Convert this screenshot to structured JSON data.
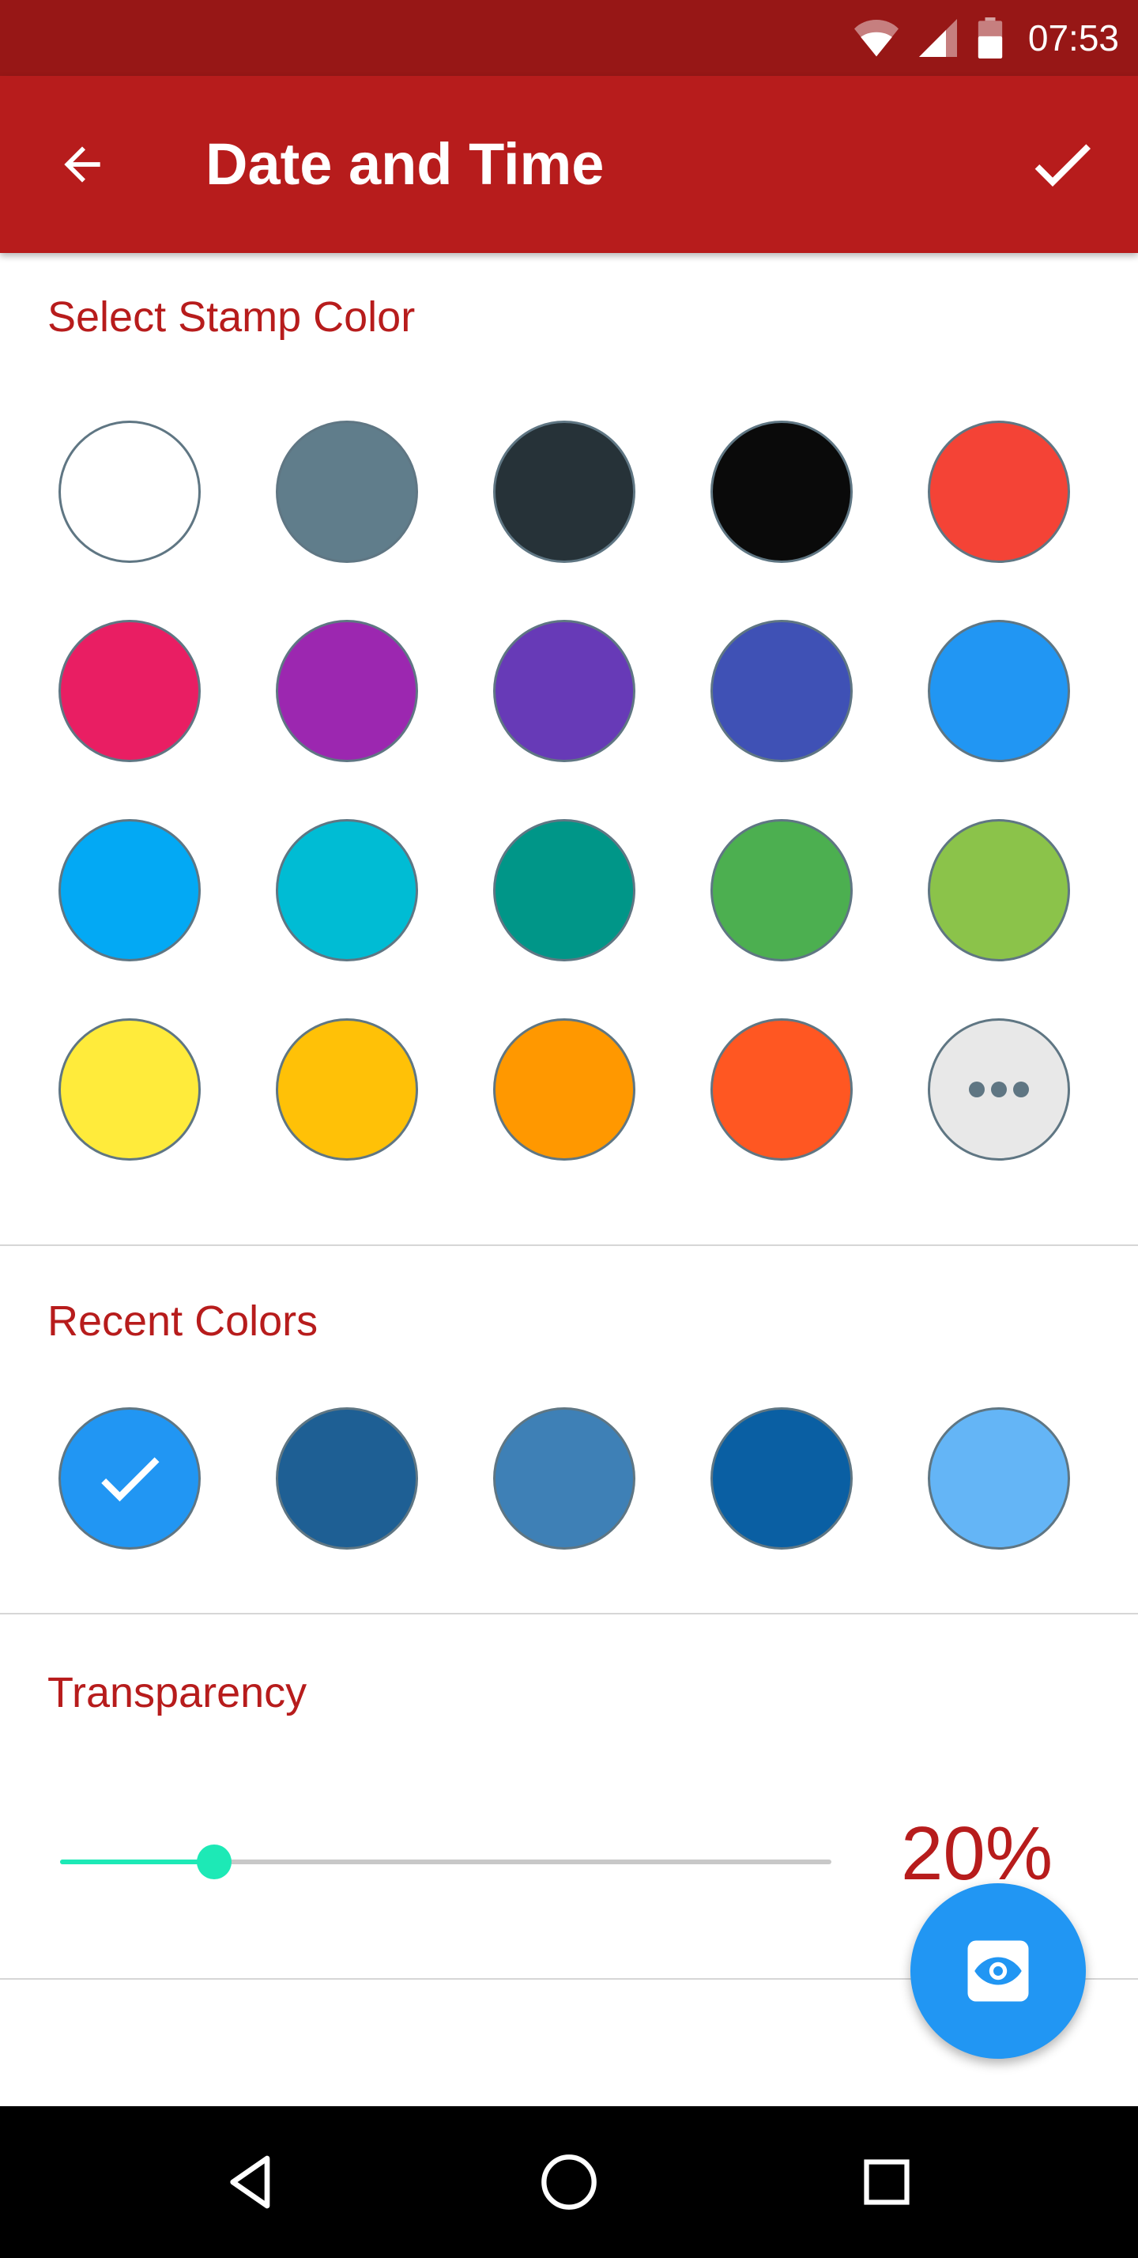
{
  "status_bar": {
    "time": "07:53"
  },
  "app_bar": {
    "title": "Date and Time",
    "back_icon": "arrow-back-icon",
    "confirm_icon": "check-icon"
  },
  "stamp_colors": {
    "title": "Select Stamp Color",
    "swatches": [
      "#FFFFFF",
      "#607D8B",
      "#263238",
      "#0A0A0A",
      "#F44336",
      "#E91E63",
      "#9C27B0",
      "#673AB7",
      "#3F51B5",
      "#2196F3",
      "#03A9F4",
      "#00BCD4",
      "#009688",
      "#4CAF50",
      "#8BC34A",
      "#FFEB3B",
      "#FFC107",
      "#FF9800",
      "#FF5722"
    ],
    "more_icon": "more-horiz-icon",
    "more_color": "#E8E8E8"
  },
  "recent_colors": {
    "title": "Recent Colors",
    "swatches": [
      "#2196F3",
      "#1E5F94",
      "#3E80B6",
      "#0A5FA3",
      "#64B5F6"
    ],
    "selected_index": 0
  },
  "transparency": {
    "title": "Transparency",
    "value_label": "20%",
    "value": 0.2
  },
  "fab": {
    "icon": "eye-icon",
    "color": "#2196F3"
  },
  "theme": {
    "status_bar": "#971716",
    "app_bar": "#B71C1C",
    "accent": "#B71C1C",
    "slider": "#1DE9B6"
  }
}
